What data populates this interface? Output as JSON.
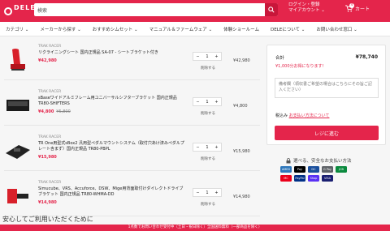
{
  "header": {
    "logo_text": "DELE",
    "search_value": "検索",
    "account_line1": "ログイン・登録",
    "account_line2": "マイアカウント ⌄",
    "cart_label": "カート",
    "cart_count": "4"
  },
  "nav": {
    "items": [
      {
        "label": "カテゴリ ⌄"
      },
      {
        "label": "メーカーから探す ⌄"
      },
      {
        "label": "おすすめシムセット ⌄"
      },
      {
        "label": "マニュアル＆ファームウェア ⌄"
      },
      {
        "label": "体験ショールーム"
      },
      {
        "label": "DELEについて ⌄"
      },
      {
        "label": "お問い合わせ窓口 ⌄"
      }
    ]
  },
  "cart_items": [
    {
      "brand": "TRAK RACER",
      "name": "リクライニングシート 国内正規品 SA-07 - シートブラケット付き",
      "price": "¥42,980",
      "old_price": "",
      "qty": "1",
      "delete": "削除する",
      "line_price": "¥42,980"
    },
    {
      "brand": "TRAK RACER",
      "name": "sBaseワイドアルミフレーム用ユニバーサルシフターブラケット 国内正規品 TR80-SHIFTERS",
      "price": "¥4,800",
      "old_price": "¥5,800",
      "qty": "1",
      "delete": "削除する",
      "line_price": "¥4,800"
    },
    {
      "brand": "TRAK RACER",
      "name": "TR One用型式sBox2 汎用型ペダルマウントシステム（取付穴あけ済みペダルプレート含まず）国内正規品 TR80-PBPL",
      "price": "¥15,980",
      "old_price": "",
      "qty": "1",
      "delete": "削除する",
      "line_price": "¥15,980"
    },
    {
      "brand": "TRAK RACER",
      "name": "Simucube、VRS、Accuforce、DSW、Mige用背面取付けダイレクトドライブブラケット 国内正規品 TR80-WHMA-DD",
      "price": "¥14,980",
      "old_price": "",
      "qty": "1",
      "delete": "削除する",
      "line_price": "¥14,980"
    }
  ],
  "summary": {
    "total_label": "合計",
    "total_value": "¥78,740",
    "shipping_msg": "¥1,000分お得になります!",
    "note_placeholder": "備考欄（領収書ご希望の場合はこちらにその旨ご記入ください）",
    "payment_prefix": "税込み",
    "payment_link": "お支払い方法について",
    "checkout_label": "レジに進む"
  },
  "secure_text": "選べる、安全なお支払い方法",
  "cards": [
    {
      "label": "AMEX",
      "color": "#2e77bb"
    },
    {
      "label": "Pay",
      "color": "#000000"
    },
    {
      "label": "DC",
      "color": "#1a4f9c"
    },
    {
      "label": "G Pay",
      "color": "#5f6368"
    },
    {
      "label": "JCB",
      "color": "#0b8a3e"
    },
    {
      "label": "MC",
      "color": "#eb001b"
    },
    {
      "label": "PayPal",
      "color": "#003087"
    },
    {
      "label": "Shop",
      "color": "#5a31f4"
    },
    {
      "label": "VISA",
      "color": "#1a1f71"
    }
  ],
  "banner_text": "安心してご利用いただくために",
  "footer_text": "1点数でお問い合わせ受付中（土日・祝日除く）全国送料無料（一部商品を除く）"
}
